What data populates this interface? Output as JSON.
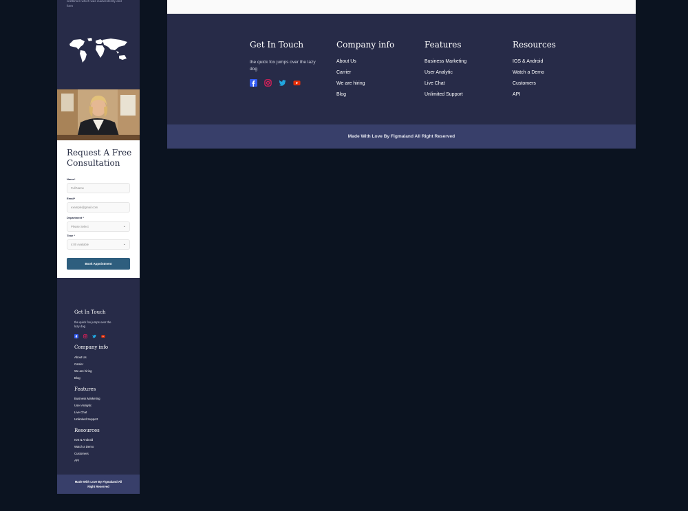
{
  "mobile": {
    "tagline": "craftsmen which was inadventently and form",
    "form": {
      "title": "Request A Free Consultation",
      "name_label": "Name*",
      "name_placeholder": "Full Name",
      "email_label": "Email*",
      "email_placeholder": "example@gmail.com",
      "department_label": "Department *",
      "department_value": "Please Select",
      "time_label": "Time *",
      "time_value": "4:00 Available",
      "submit_label": "Book Appointment"
    },
    "footer": {
      "get_in_touch": "Get In Touch",
      "description": "the quick fox jumps over the lazy dog",
      "company_title": "Company info",
      "company_links": [
        "About Us",
        "Carrier",
        "We are hiring",
        "Blog"
      ],
      "features_title": "Features",
      "features_links": [
        "Business Marketing",
        "User Analytic",
        "Live Chat",
        "Unlimited Support"
      ],
      "resources_title": "Resources",
      "resources_links": [
        "IOS & Android",
        "Watch a Demo",
        "Customers",
        "API"
      ],
      "copyright": "Made With Love By Figmaland All Right Reserved"
    }
  },
  "desktop": {
    "get_in_touch": {
      "title": "Get In Touch",
      "description": "the quick fox jumps over the lazy dog"
    },
    "company": {
      "title": "Company info",
      "links": [
        "About Us",
        "Carrier",
        "We are hiring",
        "Blog"
      ]
    },
    "features": {
      "title": "Features",
      "links": [
        "Business Marketing",
        "User Analytic",
        "Live Chat",
        "Unlimited Support"
      ]
    },
    "resources": {
      "title": "Resources",
      "links": [
        "IOS & Android",
        "Watch a Demo",
        "Customers",
        "API"
      ]
    },
    "copyright": "Made With Love By Figmaland All Right Reserved"
  },
  "colors": {
    "background": "#0b1320",
    "footer_bg": "#272b48",
    "bottom_bar": "#383f6a",
    "button": "#2e5e7e",
    "facebook": "#335bf1",
    "instagram": "#e51f5a",
    "twitter": "#21a6df",
    "youtube": "#e42f08"
  },
  "icons": [
    "world-map",
    "facebook-icon",
    "instagram-icon",
    "twitter-icon",
    "youtube-icon",
    "chevron-down-icon"
  ]
}
